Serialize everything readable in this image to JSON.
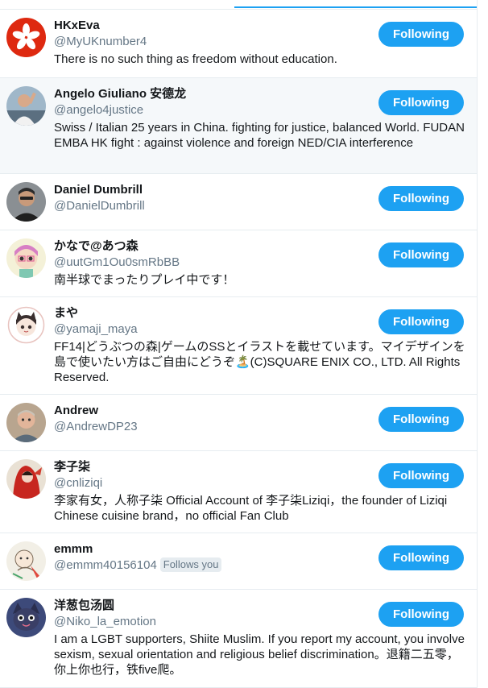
{
  "follow_label": "Following",
  "accent_color": "#1da1f2",
  "users": [
    {
      "name": "HKxEva",
      "handle": "@MyUKnumber4",
      "follows_you": "",
      "bio": "There is no such thing as freedom without education.",
      "avatar": "bauhinia-flag-avatar"
    },
    {
      "name": "Angelo Giuliano 安德龙",
      "handle": "@angelo4justice",
      "follows_you": "",
      "bio": "Swiss / Italian 25 years in China. fighting for justice, balanced World. FUDAN EMBA HK fight : against violence and foreign NED/CIA interference",
      "avatar": "person-photo-avatar"
    },
    {
      "name": "Daniel Dumbrill",
      "handle": "@DanielDumbrill",
      "follows_you": "",
      "bio": "",
      "avatar": "person-photo-avatar"
    },
    {
      "name": "かなで@あつ森",
      "handle": "@uutGm1Ou0smRbBB",
      "follows_you": "",
      "bio": "南半球でまったりプレイ中です！",
      "avatar": "game-character-avatar"
    },
    {
      "name": "まや",
      "handle": "@yamaji_maya",
      "follows_you": "",
      "bio": "FF14|どうぶつの森|ゲームのSSとイラストを載せています。マイデザインを島で使いたい方はご自由にどうぞ🏝️(C)SQUARE ENIX CO., LTD. All Rights Reserved.",
      "avatar": "illustration-avatar"
    },
    {
      "name": "Andrew",
      "handle": "@AndrewDP23",
      "follows_you": "",
      "bio": "",
      "avatar": "person-photo-avatar"
    },
    {
      "name": "李子柒",
      "handle": "@cnliziqi",
      "follows_you": "",
      "bio": "李家有女，人称子柒 Official Account of 李子柒Liziqi，the founder of Liziqi Chinese cuisine brand，no official Fan Club",
      "avatar": "person-red-cloak-avatar"
    },
    {
      "name": "emmm",
      "handle": "@emmm40156104",
      "follows_you": "Follows you",
      "bio": "",
      "avatar": "sketch-avatar"
    },
    {
      "name": "洋葱包汤圆",
      "handle": "@Niko_la_emotion",
      "follows_you": "",
      "bio": "I am a LGBT supporters, Shiite Muslim. If you report my account, you involve sexism, sexual orientation and religious belief discrimination。退籍二五零，你上你也行，铁five爬。",
      "avatar": "cartoon-cat-avatar"
    }
  ]
}
